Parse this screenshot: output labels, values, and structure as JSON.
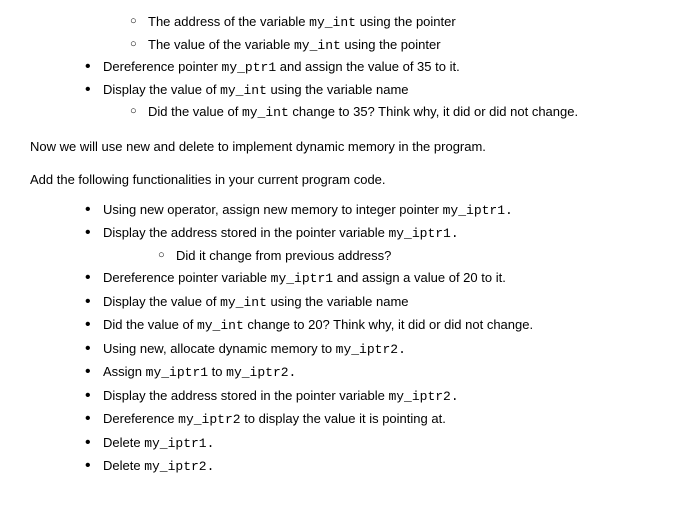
{
  "top_section": {
    "circle_a": [
      {
        "pre": "The address of the variable ",
        "code": "my_int",
        "post": " using the pointer"
      },
      {
        "pre": "The value of the variable ",
        "code": "my_int",
        "post": " using the pointer"
      }
    ],
    "bullet_a": [
      {
        "pre": "Dereference pointer ",
        "code": "my_ptr1",
        "post": " and assign the value of 35 to it."
      },
      {
        "pre": "Display the value of ",
        "code": "my_int",
        "post": " using the variable name"
      }
    ],
    "circle_b": [
      {
        "pre": "Did the value of ",
        "code": "my_int",
        "post": " change to 35? Think why, it did or did not change."
      }
    ]
  },
  "paragraphs": {
    "p1": "Now we will use new and delete to implement dynamic memory in the program.",
    "p2": "Add the following functionalities in your current program code."
  },
  "bottom_section": {
    "b1": {
      "pre": "Using new operator, assign new memory to integer pointer ",
      "code": "my_iptr1."
    },
    "b2": {
      "pre": "Display the address stored in the pointer variable ",
      "code": "my_iptr1."
    },
    "b2_sub": {
      "text": "Did it change from previous address?"
    },
    "b3": {
      "pre": "Dereference pointer variable ",
      "code": "my_iptr1",
      "post": " and assign a value of 20 to it."
    },
    "b4": {
      "pre": "Display the value of ",
      "code": "my_int",
      "post": " using the variable name"
    },
    "b5": {
      "pre": "Did the value of ",
      "code": "my_int",
      "post": " change to 20? Think why, it did or did not change."
    },
    "b6": {
      "pre": "Using new, allocate dynamic memory to ",
      "code": "my_iptr2."
    },
    "b7": {
      "pre": "Assign ",
      "code": "my_iptr1",
      "mid": " to ",
      "code2": "my_iptr2."
    },
    "b8": {
      "pre": "Display the address stored in the pointer variable ",
      "code": "my_iptr2."
    },
    "b9": {
      "pre": "Dereference ",
      "code": "my_iptr2",
      "post": "  to display the value it is pointing at."
    },
    "b10": {
      "pre": "Delete ",
      "code": "my_iptr1."
    },
    "b11": {
      "pre": "Delete ",
      "code": "my_iptr2."
    }
  }
}
